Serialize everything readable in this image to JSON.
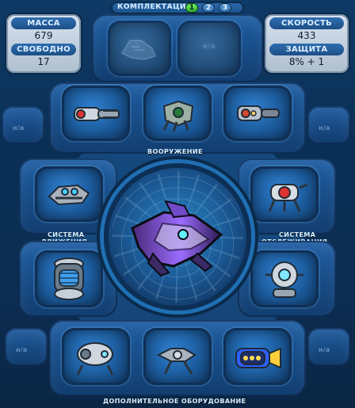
{
  "top_tabs": {
    "title": "КОМПЛЕКТАЦИЯ",
    "tabs": [
      "1",
      "2",
      "3"
    ],
    "active": "1"
  },
  "stats_left": {
    "mass_label": "МАССА",
    "mass_value": "679",
    "free_label": "СВОБОДНО",
    "free_value": "17"
  },
  "stats_right": {
    "speed_label": "СКОРОСТЬ",
    "speed_value": "433",
    "defense_label": "ЗАЩИТА",
    "defense_value": "8% + 1"
  },
  "sections": {
    "weapons": "ВООРУЖЕНИЕ",
    "movement_left": [
      "СИСТЕМА",
      "ДВИЖЕНИЯ"
    ],
    "tracking_right": [
      "СИСТЕМА",
      "ОТСЛЕЖИВАНИЯ"
    ],
    "additional_equipment": "ДОПОЛНИТЕЛЬНОЕ ОБОРУДОВАНИЕ"
  },
  "slot_hints": {
    "generic": "н/а"
  },
  "icons": {
    "weapon": "gun-icon",
    "engine": "engine-icon",
    "sensor": "sensor-icon",
    "shield": "shield-generator-icon",
    "reactor": "reactor-icon",
    "ship": "spaceship-icon"
  },
  "colors": {
    "accent_green": "#2ca62c",
    "panel_blue": "#1f5ea3",
    "text_light": "#d9f0ff"
  }
}
